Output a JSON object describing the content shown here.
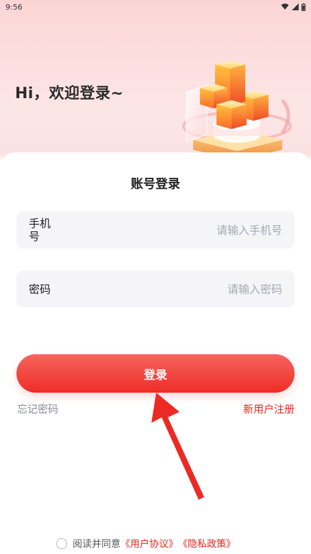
{
  "status_bar": {
    "time": "9:56"
  },
  "welcome": {
    "text": "Hi，欢迎登录~"
  },
  "card": {
    "title": "账号登录"
  },
  "phone_field": {
    "label": "手机号",
    "placeholder": "请输入手机号",
    "value": ""
  },
  "password_field": {
    "label": "密码",
    "placeholder": "请输入密码",
    "value": ""
  },
  "login_button": {
    "label": "登录"
  },
  "links": {
    "forgot": "忘记密码",
    "register": "新用户注册"
  },
  "agreement": {
    "prefix": "阅读并同意",
    "user_agreement": "《用户协议》",
    "privacy_policy": "《隐私政策》",
    "checked": false
  },
  "colors": {
    "accent": "#ee2d26",
    "link_red": "#e8251f",
    "field_bg": "#f5f5f7",
    "hero_bg": "#fbd5d6"
  },
  "icons": {
    "status": [
      "wifi-icon",
      "signal-icon",
      "battery-icon"
    ],
    "hero": "cube-stack-illustration",
    "annotation": "red-arrow-icon"
  }
}
